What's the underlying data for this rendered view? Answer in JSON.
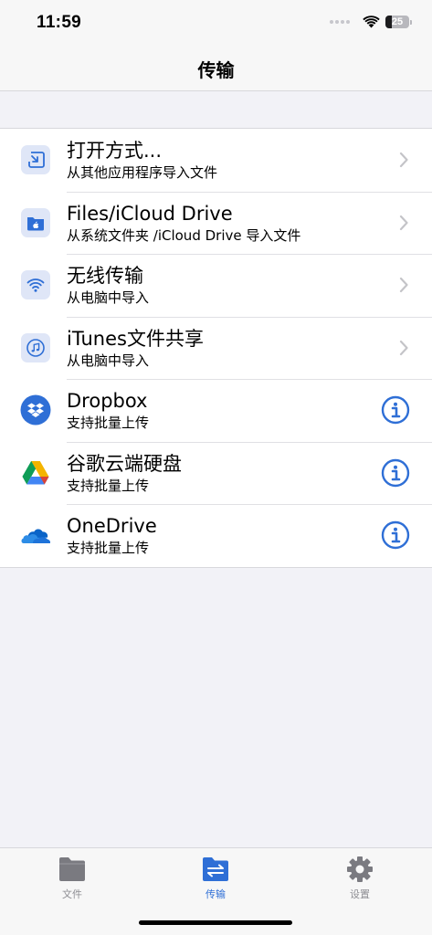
{
  "status_bar": {
    "time": "11:59",
    "battery": "25"
  },
  "nav": {
    "title": "传输"
  },
  "rows": [
    {
      "title": "打开方式...",
      "subtitle": "从其他应用程序导入文件",
      "icon": "import-icon",
      "accessory": "chevron"
    },
    {
      "title": "Files/iCloud Drive",
      "subtitle": "从系统文件夹 /iCloud Drive 导入文件",
      "icon": "files-app-icon",
      "accessory": "chevron"
    },
    {
      "title": "无线传输",
      "subtitle": "从电脑中导入",
      "icon": "wifi-icon",
      "accessory": "chevron"
    },
    {
      "title": "iTunes文件共享",
      "subtitle": "从电脑中导入",
      "icon": "music-note-icon",
      "accessory": "chevron"
    },
    {
      "title": "Dropbox",
      "subtitle": "支持批量上传",
      "icon": "dropbox-icon",
      "accessory": "info"
    },
    {
      "title": "谷歌云端硬盘",
      "subtitle": "支持批量上传",
      "icon": "google-drive-icon",
      "accessory": "info"
    },
    {
      "title": "OneDrive",
      "subtitle": "支持批量上传",
      "icon": "onedrive-icon",
      "accessory": "info"
    }
  ],
  "tabs": [
    {
      "label": "文件",
      "icon": "folder-icon",
      "active": false
    },
    {
      "label": "传输",
      "icon": "transfer-icon",
      "active": true
    },
    {
      "label": "设置",
      "icon": "gear-icon",
      "active": false
    }
  ],
  "colors": {
    "accent": "#2f6fd6",
    "icon_tile": "#dfe6f7",
    "inactive": "#8e8e93"
  }
}
